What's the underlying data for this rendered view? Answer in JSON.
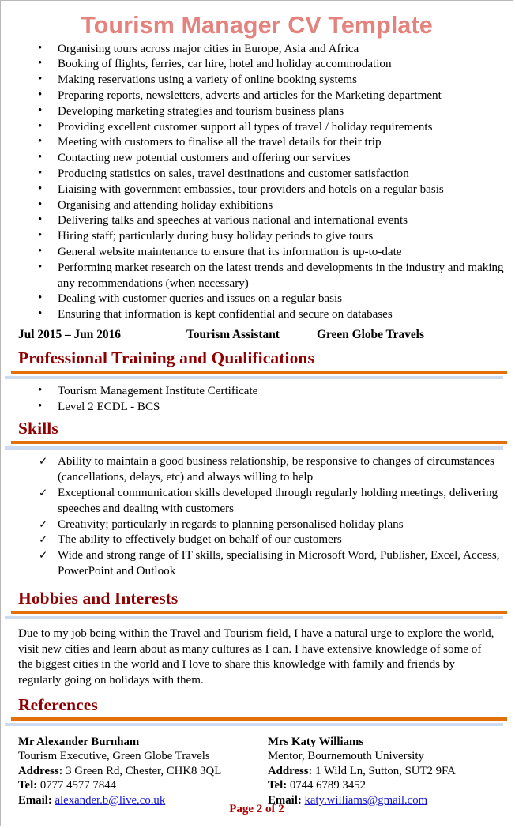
{
  "document": {
    "title": "Tourism Manager CV Template",
    "footer": "Page 2 of 2"
  },
  "colors": {
    "title": "#e4827d",
    "heading": "#900000",
    "rule_orange": "#e2700a",
    "rule_blue": "#ccdbf0",
    "link": "#1515d0",
    "footer": "#aa0000"
  },
  "duties": {
    "items": [
      "Organising tours across major cities in Europe, Asia and Africa",
      "Booking of flights, ferries, car hire, hotel and holiday accommodation",
      "Making reservations using a variety of online booking systems",
      "Preparing reports, newsletters, adverts and articles for the Marketing department",
      "Developing marketing strategies and tourism business plans",
      "Providing excellent customer support all types of travel / holiday requirements",
      "Meeting with customers to finalise all the travel details for their trip",
      "Contacting new potential customers and offering our services",
      "Producing statistics on sales, travel destinations and customer satisfaction",
      "Liaising with government embassies, tour providers and hotels on a regular basis",
      "Organising and attending holiday exhibitions",
      "Delivering talks and speeches at various national and international events",
      "Hiring staff; particularly during busy holiday periods to give tours",
      "General website maintenance to ensure that its information is up-to-date",
      "Performing market research on the latest trends and developments in the industry and making any recommendations (when necessary)",
      "Dealing with customer queries and issues on a regular basis",
      "Ensuring that information is kept confidential and secure on databases"
    ]
  },
  "job_entry": {
    "dates": "Jul 2015 – Jun 2016",
    "job_title": "Tourism Assistant",
    "company": "Green Globe Travels"
  },
  "sections": {
    "training": {
      "heading": "Professional Training and Qualifications",
      "items": [
        "Tourism Management Institute Certificate",
        "Level 2 ECDL - BCS"
      ]
    },
    "skills": {
      "heading": "Skills",
      "items": [
        "Ability to maintain a good business relationship, be responsive to changes of circumstances (cancellations, delays, etc) and always willing to help",
        "Exceptional communication skills developed through regularly holding meetings, delivering speeches and dealing with customers",
        "Creativity; particularly in regards to planning personalised holiday plans",
        "The ability to effectively budget on behalf of our customers",
        "Wide and strong range of IT skills, specialising in Microsoft Word, Publisher, Excel, Access, PowerPoint and Outlook"
      ]
    },
    "hobbies": {
      "heading": "Hobbies and Interests",
      "paragraph": "Due to my job being within the Travel and Tourism field, I have a natural urge to explore the world, visit new cities and learn about as many cultures as I can. I have extensive knowledge of some of the biggest cities in the world and I love to share this knowledge with family and friends by regularly going on holidays with them."
    },
    "references": {
      "heading": "References",
      "labels": {
        "address": "Address:",
        "tel": "Tel:",
        "email": "Email:"
      },
      "entries": [
        {
          "name": "Mr Alexander Burnham",
          "role": "Tourism Executive, Green Globe Travels",
          "address": "3 Green Rd, Chester, CHK8 3QL",
          "tel": "0777 4577 7844",
          "email": "alexander.b@live.co.uk"
        },
        {
          "name": "Mrs Katy Williams",
          "role": "Mentor, Bournemouth University",
          "address": "1 Wild Ln, Sutton, SUT2 9FA",
          "tel": "0744 6789 3452",
          "email": "katy.williams@gmail.com"
        }
      ]
    }
  }
}
